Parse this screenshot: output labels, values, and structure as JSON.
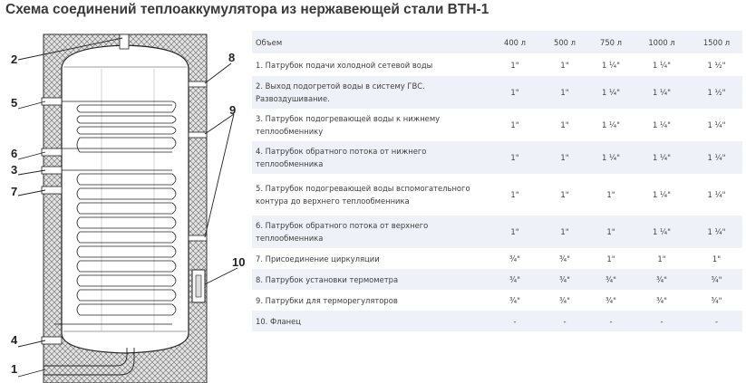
{
  "title": "Схема соединений теплоаккумулятора из нержавеющей стали BTH-1",
  "diagram": {
    "labels": [
      "1",
      "2",
      "3",
      "4",
      "5",
      "6",
      "7",
      "8",
      "9",
      "10"
    ]
  },
  "table": {
    "header": {
      "name": "Объем",
      "volumes": [
        "400 л",
        "500 л",
        "750 л",
        "1000 л",
        "1500 л"
      ]
    },
    "rows": [
      {
        "name": "1. Патрубок подачи холодной сетевой воды",
        "values": [
          "1\"",
          "1\"",
          "1 ¼\"",
          "1 ¼\"",
          "1 ½\""
        ]
      },
      {
        "name": "2. Выход подогретой воды в систему ГВС. Развоздушивание.",
        "values": [
          "1\"",
          "1\"",
          "1 ¼\"",
          "1 ¼\"",
          "1 ½\""
        ]
      },
      {
        "name": "3. Патрубок подогревающей воды к нижнему теплообменнику",
        "values": [
          "1\"",
          "1\"",
          "1 ¼\"",
          "1 ¼\"",
          "1 ¼\""
        ]
      },
      {
        "name": "4. Патрубок обратного потока от нижнего теплообменника",
        "values": [
          "1\"",
          "1\"",
          "1 ¼\"",
          "1 ¼\"",
          "1 ¼\""
        ]
      },
      {
        "name": "5. Патрубок подогревающей воды вспомогательного контура до верхнего теплообменника",
        "values": [
          "1\"",
          "1\"",
          "1\"",
          "1 ¼\"",
          "1 ¼\""
        ]
      },
      {
        "name": "6. Патрубок обратного потока от верхнего теплообменника",
        "values": [
          "1\"",
          "1\"",
          "1\"",
          "1 ¼\"",
          "1 ¼\""
        ]
      },
      {
        "name": "7. Присоединение циркуляции",
        "values": [
          "¾\"",
          "¾\"",
          "1\"",
          "1\"",
          "1\""
        ]
      },
      {
        "name": "8. Патрубок установки термометра",
        "values": [
          "¾\"",
          "¾\"",
          "¾\"",
          "¾\"",
          "¾\""
        ]
      },
      {
        "name": "9. Патрубки для терморегуляторов",
        "values": [
          "¾\"",
          "¾\"",
          "¾\"",
          "¾\"",
          "¾\""
        ]
      },
      {
        "name": "10. Фланец",
        "values": [
          "-",
          "-",
          "-",
          "-",
          "-"
        ]
      }
    ]
  }
}
